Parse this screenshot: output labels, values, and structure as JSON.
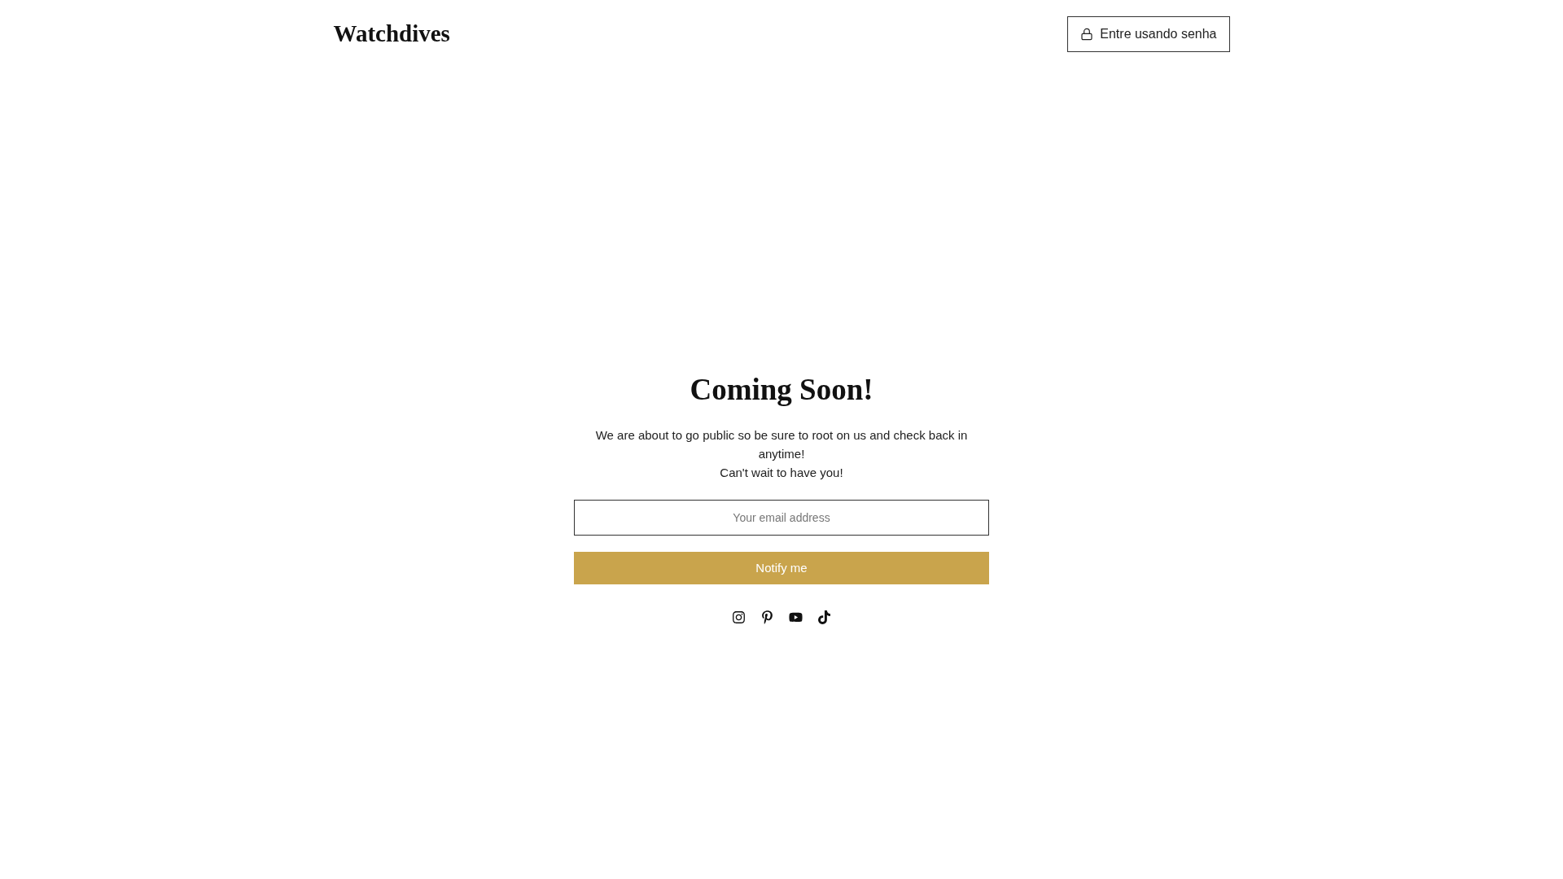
{
  "header": {
    "logo": "Watchdives",
    "login_button": "Entre usando senha"
  },
  "main": {
    "heading": "Coming Soon!",
    "paragraph": [
      "We are about to go public so be sure to root on us and check back in anytime!",
      "Can't wait to have you!"
    ],
    "email_field": {
      "placeholder": "Your email address"
    },
    "submit_button": "Notify me"
  }
}
